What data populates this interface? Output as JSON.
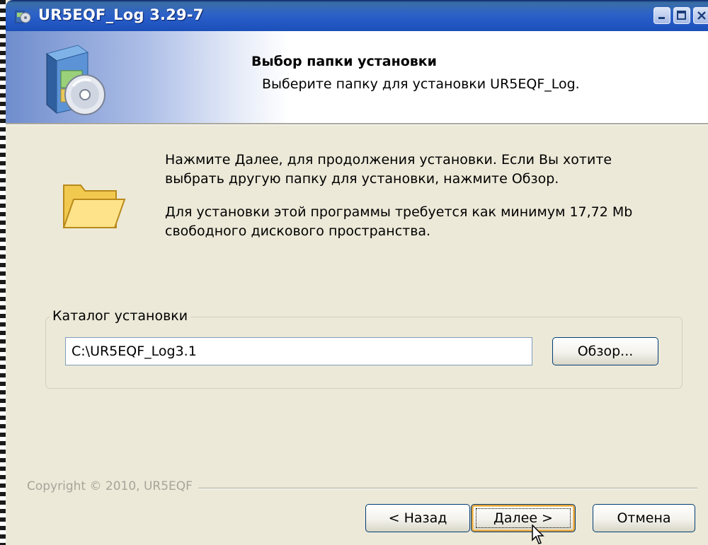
{
  "window": {
    "title": "UR5EQF_Log 3.29-7"
  },
  "header": {
    "title": "Выбор папки установки",
    "subtitle": "Выберите папку для установки UR5EQF_Log."
  },
  "body": {
    "line1": "Нажмите Далее, для продолжения установки. Если Вы хотите",
    "line2": "выбрать другую папку для установки, нажмите Обзор.",
    "line3": "Для установки этой программы требуется как минимум 17,72 Mb",
    "line4": "свободного дискового пространства."
  },
  "install_dir": {
    "group_label": "Каталог установки",
    "path_value": "C:\\UR5EQF_Log3.1",
    "browse_label": "Обзор..."
  },
  "footer": {
    "copyright": "Copyright © 2010, UR5EQF",
    "back_label": "< Назад",
    "next_label": "Далее >",
    "cancel_label": "Отмена"
  },
  "icons": {
    "title": "installer-icon",
    "header": "setup-disc-box-icon",
    "folder": "open-folder-icon"
  },
  "colors": {
    "titlebar": "#2458c4",
    "dialog_bg": "#ece9d8",
    "button_border": "#003c74",
    "focus_highlight": "#e3a33e"
  }
}
